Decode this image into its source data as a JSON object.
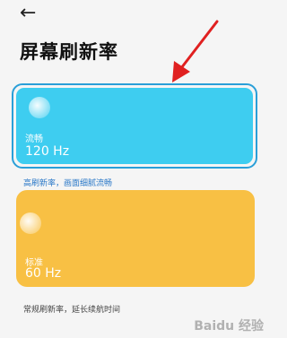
{
  "header": {
    "back_icon": "←",
    "title": "屏幕刷新率"
  },
  "modes": [
    {
      "name": "流畅",
      "rate": "120 Hz",
      "description": "高刷新率，画面细腻流畅",
      "color": "#3ecdf0",
      "selected": true
    },
    {
      "name": "标准",
      "rate": "60 Hz",
      "description": "常规刷新率，延长续航时间",
      "color": "#f8c044",
      "selected": false
    }
  ],
  "annotation_color": "#e02020",
  "watermark": "Baidu 经验"
}
